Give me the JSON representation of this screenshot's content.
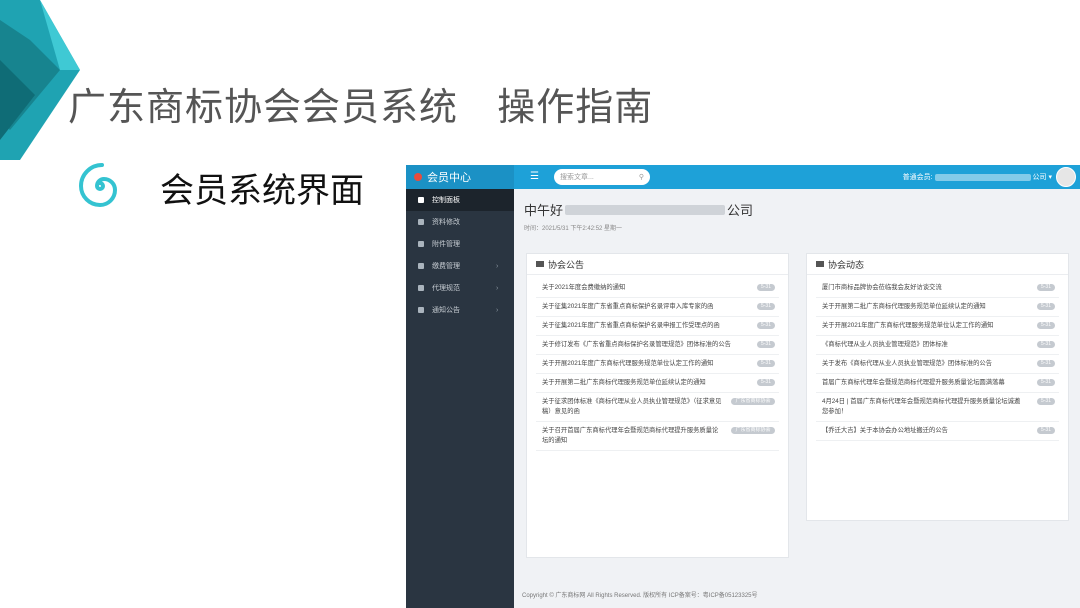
{
  "slide": {
    "title": "广东商标协会会员系统   操作指南",
    "subtitle": "会员系统界面"
  },
  "app": {
    "brand": "会员中心",
    "search_placeholder": "搜索文章...",
    "user_label": "普通会员:",
    "user_company_suffix": "公司",
    "greeting_prefix": "中午好",
    "greeting_suffix": "公司",
    "time_text": "时间：2021/5/31 下午2:42:52 星期一",
    "sidebar": [
      {
        "label": "控制面板",
        "active": true,
        "has_arrow": false
      },
      {
        "label": "资料修改",
        "active": false,
        "has_arrow": false
      },
      {
        "label": "附件管理",
        "active": false,
        "has_arrow": false
      },
      {
        "label": "缴费管理",
        "active": false,
        "has_arrow": true
      },
      {
        "label": "代理规范",
        "active": false,
        "has_arrow": true
      },
      {
        "label": "通知公告",
        "active": false,
        "has_arrow": true
      }
    ],
    "announcements": {
      "title": "协会公告",
      "items": [
        {
          "text": "关于2021年度会费缴纳的通知",
          "badge": "5-31"
        },
        {
          "text": "关于征集2021年度广东省重点商标保护名录评审入库专家的函",
          "badge": "5-31"
        },
        {
          "text": "关于征集2021年度广东省重点商标保护名录申报工作受理点的函",
          "badge": "5-31"
        },
        {
          "text": "关于修订发布《广东省重点商标保护名录管理规范》团体标准的公告",
          "badge": "5-31"
        },
        {
          "text": "关于开展2021年度广东商标代理服务规范单位认定工作的通知",
          "badge": "5-31"
        },
        {
          "text": "关于开展第二批广东商标代理服务规范单位延续认定的通知",
          "badge": "5-31"
        },
        {
          "text": "关于征求团体标准《商标代理从业人员执业管理规范》（征求意见稿）意见的函",
          "badge": "广东省商标协会"
        },
        {
          "text": "关于召开首届广东商标代理年会暨规范商标代理提升服务质量论坛的通知",
          "badge": "广东省商标协会"
        }
      ]
    },
    "news": {
      "title": "协会动态",
      "items": [
        {
          "text": "厦门市商标品牌协会莅临我会友好访谈交流",
          "badge": "5-31"
        },
        {
          "text": "关于开展第二批广东商标代理服务规范单位延续认定的通知",
          "badge": "5-31"
        },
        {
          "text": "关于开展2021年度广东商标代理服务规范单位认定工作的通知",
          "badge": "5-31"
        },
        {
          "text": "《商标代理从业人员执业管理规范》团体标准",
          "badge": "5-31"
        },
        {
          "text": "关于发布《商标代理从业人员执业管理规范》团体标准的公告",
          "badge": "5-31"
        },
        {
          "text": "首届广东商标代理年会暨规范商标代理提升服务质量论坛圆满落幕",
          "badge": "5-31"
        },
        {
          "text": "4月24日 | 首届广东商标代理年会暨规范商标代理提升服务质量论坛诚邀您参加！",
          "badge": "5-31"
        },
        {
          "text": "【乔迁大吉】关于本协会办公地址搬迁的公告",
          "badge": "5-31"
        }
      ]
    },
    "footer": "Copyright © 广东商标网 All Rights Reserved. 版权所有 ICP备案号：粤ICP备05123325号"
  },
  "colors": {
    "topbar": "#1ea1d8",
    "sidebar": "#2a3541",
    "accent_teal": "#2fc4cf"
  }
}
